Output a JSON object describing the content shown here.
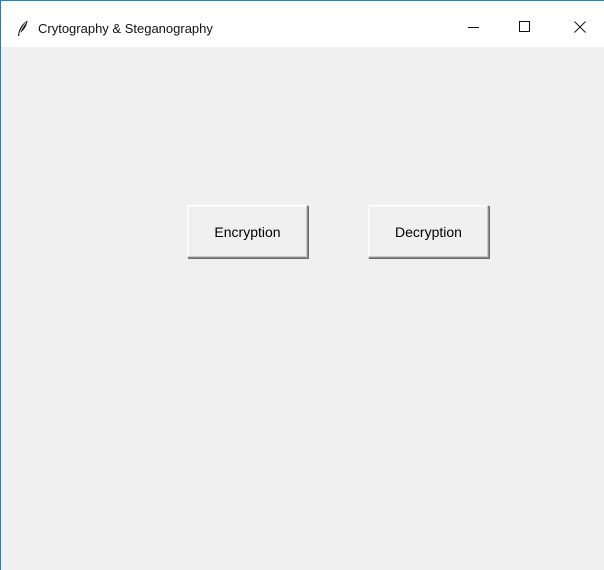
{
  "window": {
    "title": "Crytography & Steganography",
    "icon": "feather-icon",
    "controls": {
      "minimize_icon": "minimize-icon",
      "maximize_icon": "maximize-icon",
      "close_icon": "close-icon"
    }
  },
  "main": {
    "encryption_label": "Encryption",
    "decryption_label": "Decryption"
  },
  "colors": {
    "window_border": "#1883d7",
    "client_background": "#f0f0f0",
    "titlebar_background": "#ffffff"
  }
}
